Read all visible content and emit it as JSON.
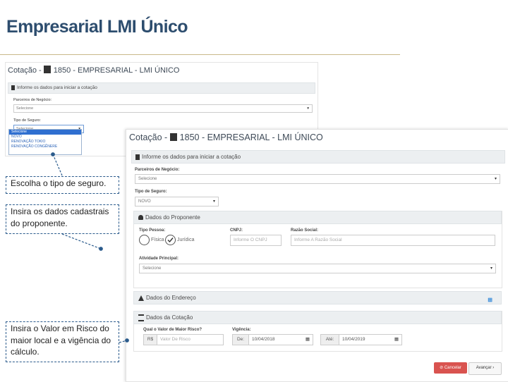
{
  "slide": {
    "title": "Empresarial LMI Único"
  },
  "screenshot_back": {
    "header": "Cotação - 1850 - EMPRESARIAL - LMI ÚNICO",
    "section_title": "Informe os dados para iniciar a cotação",
    "partner_label": "Parceiros de Negócio:",
    "partner_value": "Selecione",
    "insurance_type_label": "Tipo de Seguro:",
    "insurance_type_value": "Selecione",
    "dropdown_options": [
      "Selecione",
      "NOVO",
      "RENOVAÇÃO TOKIO",
      "RENOVAÇÃO CONGÊNERE"
    ]
  },
  "screenshot_front": {
    "header": "Cotação - 1850 - EMPRESARIAL - LMI ÚNICO",
    "section_main": "Informe os dados para iniciar a cotação",
    "partner_label": "Parceiros de Negócio:",
    "partner_value": "Selecione",
    "insurance_type_label": "Tipo de Seguro:",
    "insurance_type_value": "NOVO",
    "section_proponent": "Dados do Proponente",
    "person_type_label": "Tipo Pessoa:",
    "person_type_options": [
      "Física",
      "Jurídica"
    ],
    "person_type_selected": "Jurídica",
    "cnpj_label": "CNPJ:",
    "cnpj_placeholder": "Informe O CNPJ",
    "company_label": "Razão Social:",
    "company_placeholder": "Informe A Razão Social",
    "activity_label": "Atividade Principal:",
    "activity_value": "Selecione",
    "section_address": "Dados do Endereço",
    "section_quote": "Dados da Cotação",
    "value_label": "Qual o Valor de Maior Risco?",
    "currency_prefix": "R$",
    "value_placeholder": "Valor De Risco",
    "validity_label": "Vigência:",
    "from_prefix": "De:",
    "from_date": "10/04/2018",
    "to_prefix": "Até:",
    "to_date": "10/04/2019",
    "cancel_label": "Cancelar",
    "next_label": "Avançar"
  },
  "callouts": [
    "Escolha o tipo de seguro.",
    "Insira os dados cadastrais do proponente.",
    "Insira o Valor em Risco do maior local e a vigência do cálculo."
  ],
  "colors": {
    "title": "#2d4d6e",
    "callout_border": "#2b5b8c",
    "cancel_button": "#d9534f",
    "dropdown_highlight": "#2f6fd0"
  }
}
